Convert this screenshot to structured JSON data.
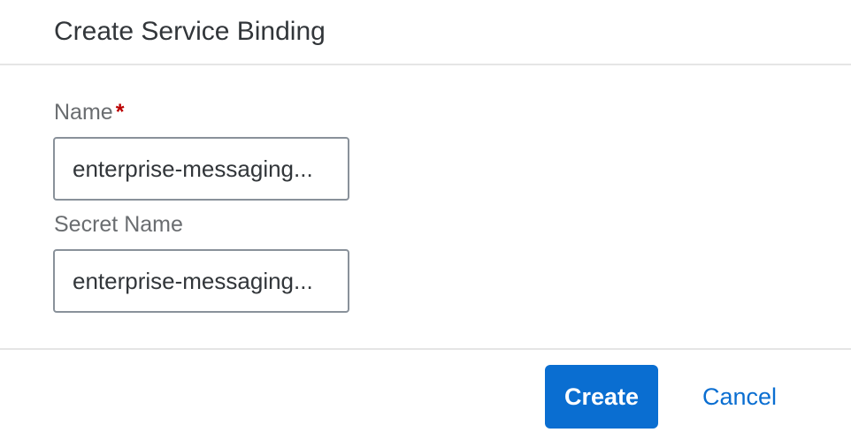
{
  "dialog": {
    "title": "Create Service Binding"
  },
  "form": {
    "name": {
      "label": "Name",
      "required_mark": "*",
      "value": "enterprise-messaging..."
    },
    "secret_name": {
      "label": "Secret Name",
      "value": "enterprise-messaging..."
    }
  },
  "footer": {
    "create_label": "Create",
    "cancel_label": "Cancel"
  },
  "colors": {
    "accent": "#0a6ed1",
    "required": "#bb0000",
    "label": "#6a6d70",
    "border": "#89919a"
  }
}
